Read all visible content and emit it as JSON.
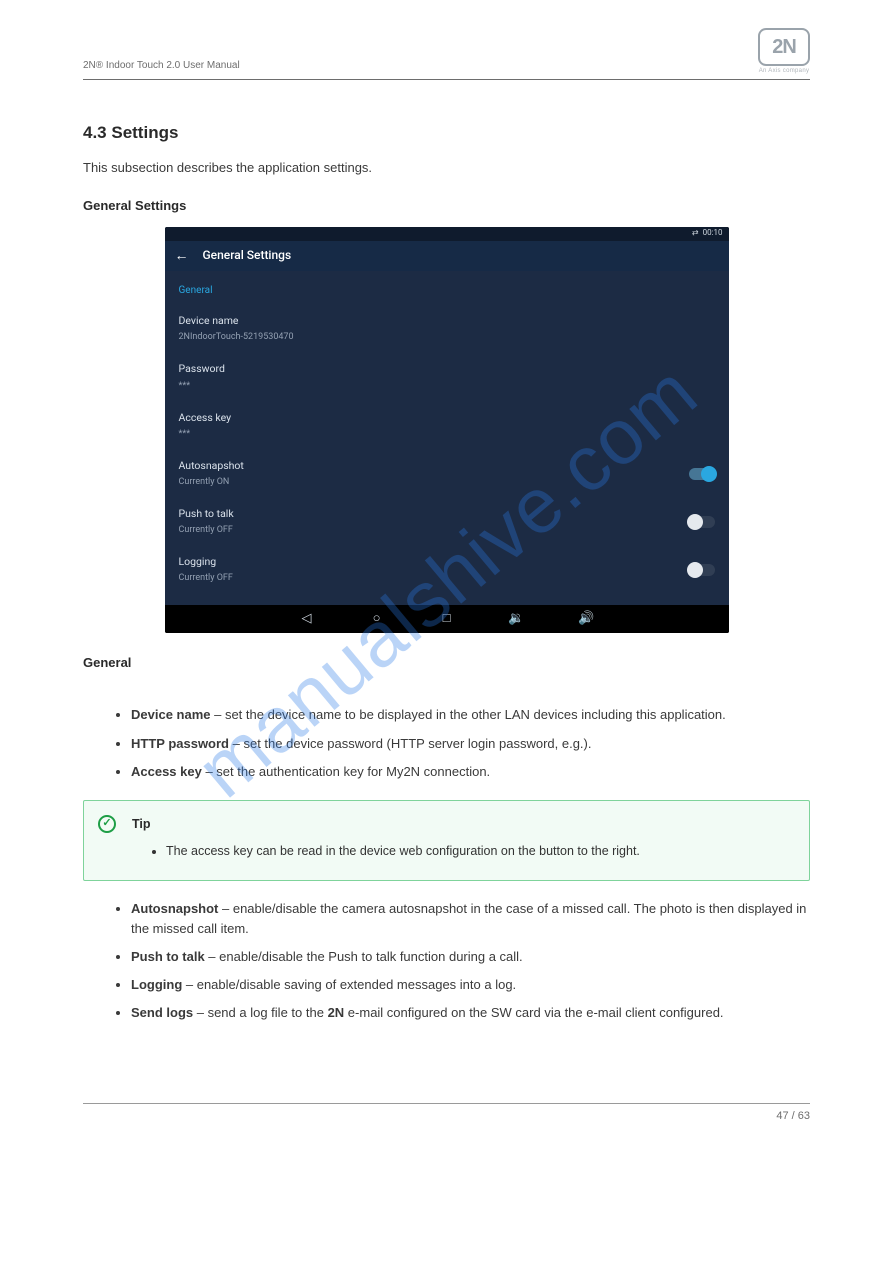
{
  "brand": {
    "name": "2N",
    "sub": "An Axis company"
  },
  "header": "2N® Indoor Touch 2.0 User Manual",
  "h2": "4.3 Settings",
  "intro": "This subsection describes the application settings.",
  "h3_general": "General Settings",
  "screenshot": {
    "status_time": "00:10",
    "appbar_title": "General Settings",
    "section": "General",
    "rows": {
      "device": {
        "title": "Device name",
        "sub": "2NIndoorTouch-5219530470"
      },
      "password": {
        "title": "Password",
        "sub": "***"
      },
      "access": {
        "title": "Access key",
        "sub": "***"
      },
      "auto": {
        "title": "Autosnapshot",
        "sub": "Currently ON",
        "on": true
      },
      "ptt": {
        "title": "Push to talk",
        "sub": "Currently OFF",
        "on": false
      },
      "log": {
        "title": "Logging",
        "sub": "Currently OFF",
        "on": false
      }
    }
  },
  "h3_general2": "General",
  "bullets": {
    "b1": {
      "label": "Device name",
      "text": " – set the device name to be displayed in the other LAN devices including this application."
    },
    "b2": {
      "label": "HTTP password",
      "text": " – set the device password (HTTP server login password, e.g.)."
    },
    "b3": {
      "label": "Access key",
      "text": " – set the authentication key for My2N connection."
    }
  },
  "tip": {
    "title": "Tip",
    "text": "The access key can be read in the device web configuration on the button to the right."
  },
  "bullets2": {
    "b4": {
      "label": "Autosnapshot",
      "text": " – enable/disable the camera autosnapshot in the case of a missed call. The photo is then displayed in the missed call item."
    },
    "b5": {
      "label": "Push to talk",
      "text": " – enable/disable the Push to talk function during a call."
    },
    "b6": {
      "label": "Logging",
      "text": " – enable/disable saving of extended messages into a log."
    },
    "b7": {
      "label": "Send logs",
      "text": " – send a log file to the ",
      "text2": " e-mail configured on the SW card via the e-mail client configured."
    }
  },
  "send_logs_brand": "2N",
  "watermark": "manualshive.com",
  "page_number": "47 / 63"
}
